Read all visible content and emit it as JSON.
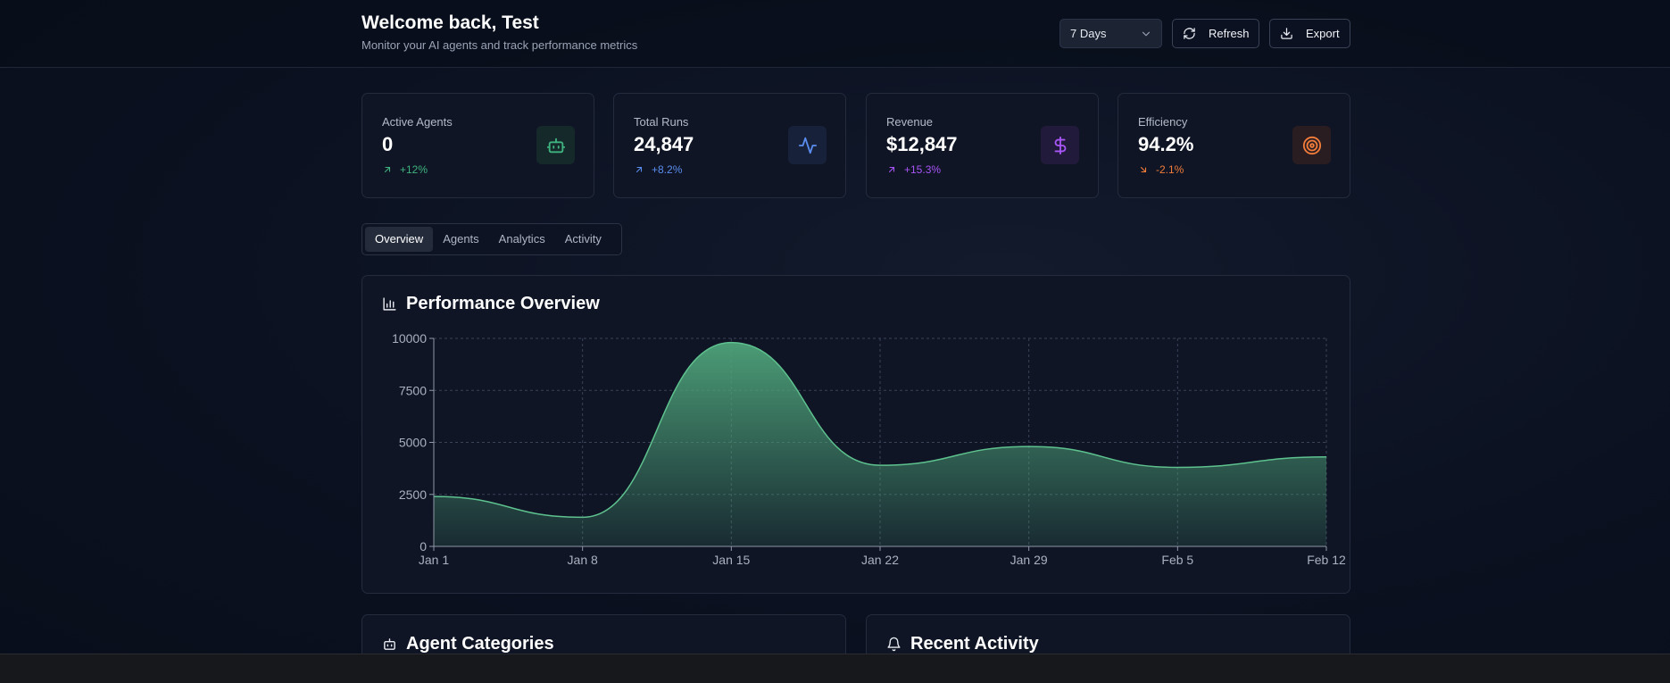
{
  "header": {
    "title": "Welcome back, Test",
    "subtitle": "Monitor your AI agents and track performance metrics",
    "range_select": {
      "value": "7 Days",
      "icon": "chevron-down-icon"
    },
    "refresh_label": "Refresh",
    "export_label": "Export"
  },
  "stats": [
    {
      "label": "Active Agents",
      "value": "0",
      "delta": "+12%",
      "trend": "up",
      "icon": "bot-icon",
      "color": "#3fb37f",
      "bg": "#15282a"
    },
    {
      "label": "Total Runs",
      "value": "24,847",
      "delta": "+8.2%",
      "trend": "up",
      "icon": "activity-icon",
      "color": "#5b8def",
      "bg": "#17213a"
    },
    {
      "label": "Revenue",
      "value": "$12,847",
      "delta": "+15.3%",
      "trend": "up",
      "icon": "dollar-icon",
      "color": "#a855f7",
      "bg": "#221a3a"
    },
    {
      "label": "Efficiency",
      "value": "94.2%",
      "delta": "-2.1%",
      "trend": "down",
      "icon": "target-icon",
      "color": "#f27c3a",
      "bg": "#2a1d22"
    }
  ],
  "tabs": [
    "Overview",
    "Agents",
    "Analytics",
    "Activity"
  ],
  "active_tab": "Overview",
  "performance": {
    "title": "Performance Overview",
    "icon": "bar-chart-icon"
  },
  "chart_data": {
    "type": "area",
    "title": "",
    "xlabel": "",
    "ylabel": "",
    "x": [
      "Jan 1",
      "Jan 8",
      "Jan 15",
      "Jan 22",
      "Jan 29",
      "Feb 5",
      "Feb 12"
    ],
    "series": [
      {
        "values": [
          2400,
          1400,
          9800,
          3900,
          4800,
          3800,
          4300
        ]
      }
    ],
    "yticks": [
      "0",
      "2500",
      "5000",
      "7500",
      "10000"
    ],
    "ylim": [
      0,
      10000
    ],
    "grid": true,
    "color": "#4ea37a"
  },
  "bottom": {
    "categories_title": "Agent Categories",
    "categories_icon": "bot-icon",
    "activity_title": "Recent Activity",
    "activity_icon": "bell-icon"
  }
}
